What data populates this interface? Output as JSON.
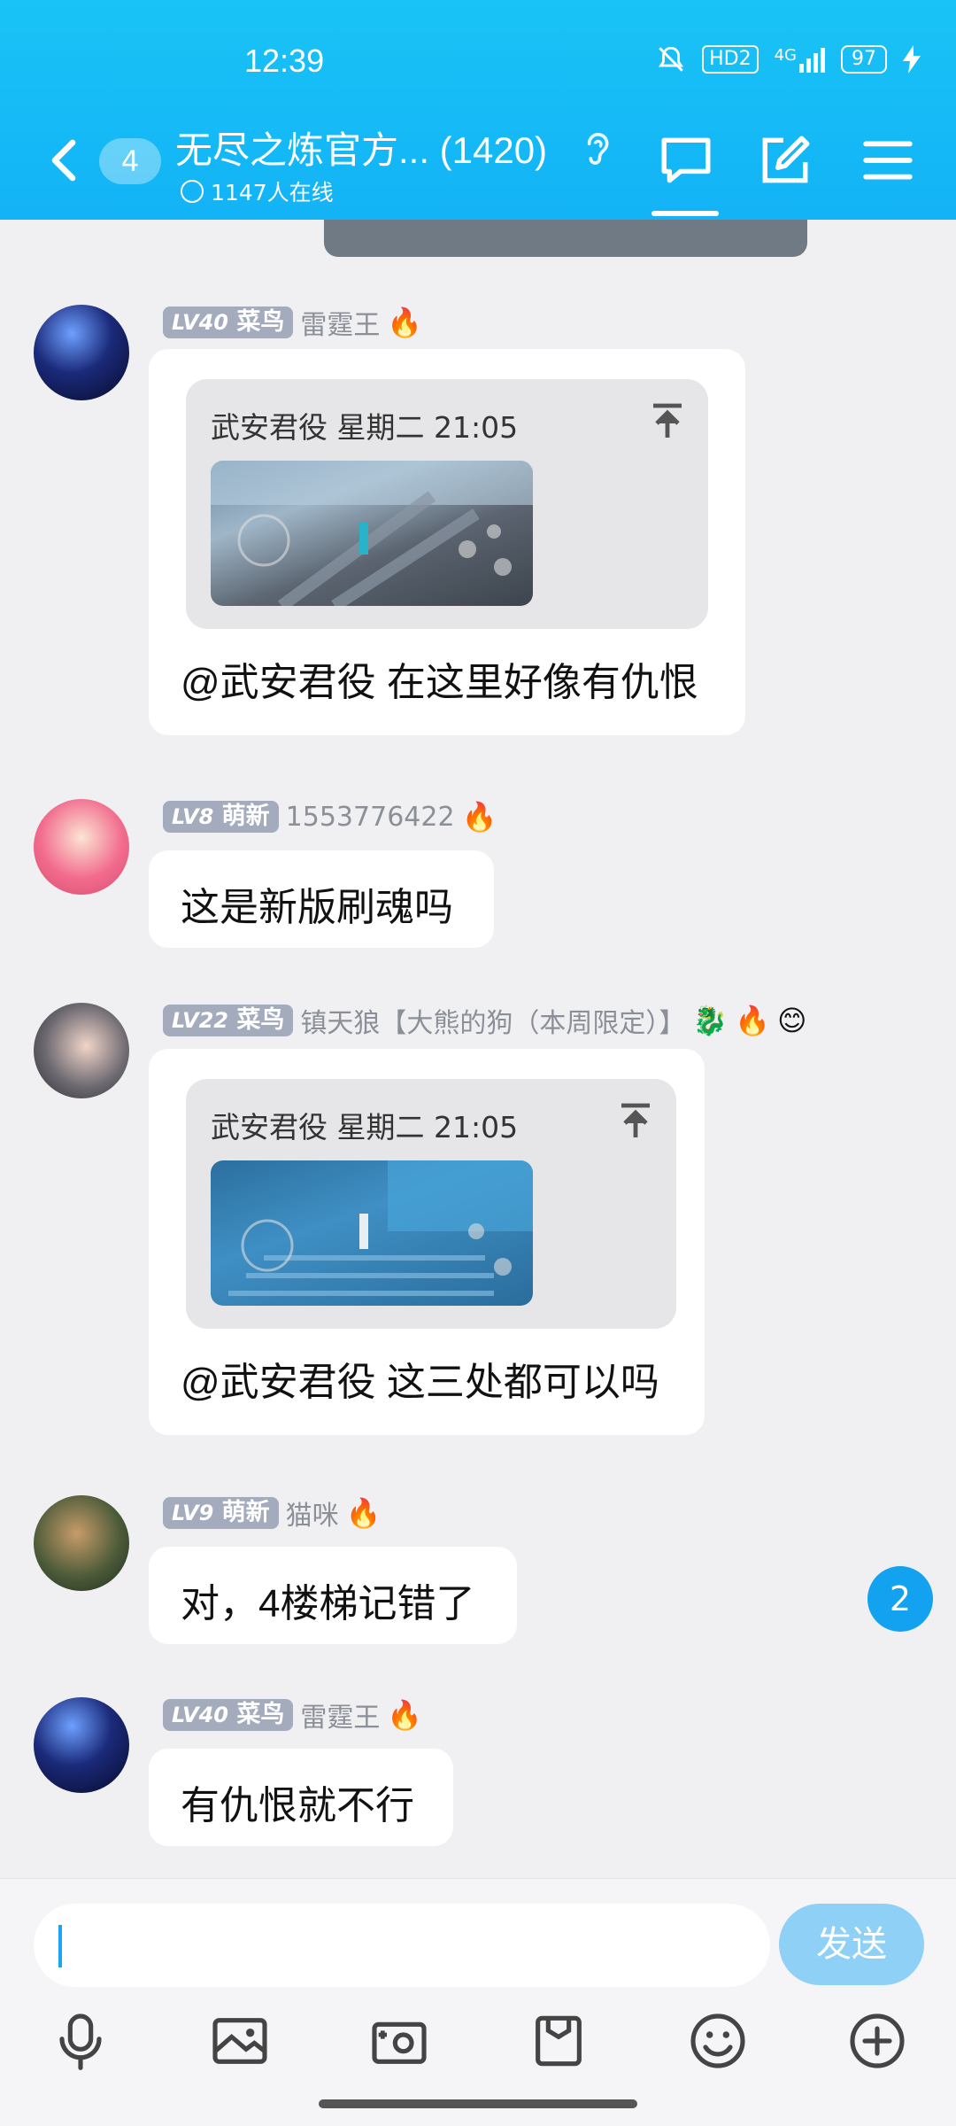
{
  "status_bar": {
    "time": "12:39",
    "hd": "HD2",
    "signal": "4G",
    "battery": "97"
  },
  "header": {
    "unread_count": "4",
    "title": "无尽之炼官方... (1420)",
    "online": "1147人在线"
  },
  "messages": [
    {
      "level": "LV40",
      "rank": "菜鸟",
      "nickname": "雷霆王",
      "badges": [
        "🔥"
      ],
      "quote": {
        "header": "武安君役 星期二 21:05"
      },
      "text": "@武安君役 在这里好像有仇恨"
    },
    {
      "level": "LV8",
      "rank": "萌新",
      "nickname": "1553776422",
      "badges": [
        "🔥"
      ],
      "text": "这是新版刷魂吗"
    },
    {
      "level": "LV22",
      "rank": "菜鸟",
      "nickname": "镇天狼【大熊的狗（本周限定）】",
      "badges": [
        "🐉",
        "🔥",
        "😊"
      ],
      "quote": {
        "header": "武安君役 星期二 21:05"
      },
      "text": "@武安君役 这三处都可以吗"
    },
    {
      "level": "LV9",
      "rank": "萌新",
      "nickname": "猫咪",
      "badges": [
        "🔥"
      ],
      "text": "对，4楼梯记错了"
    },
    {
      "level": "LV40",
      "rank": "菜鸟",
      "nickname": "雷霆王",
      "badges": [
        "🔥"
      ],
      "text": "有仇恨就不行"
    }
  ],
  "new_message_badge": "2",
  "input": {
    "placeholder": "",
    "send_label": "发送"
  },
  "colors": {
    "header": "#13b3f6",
    "accent": "#1aa4f2",
    "level_tag": "#a3abbc"
  }
}
